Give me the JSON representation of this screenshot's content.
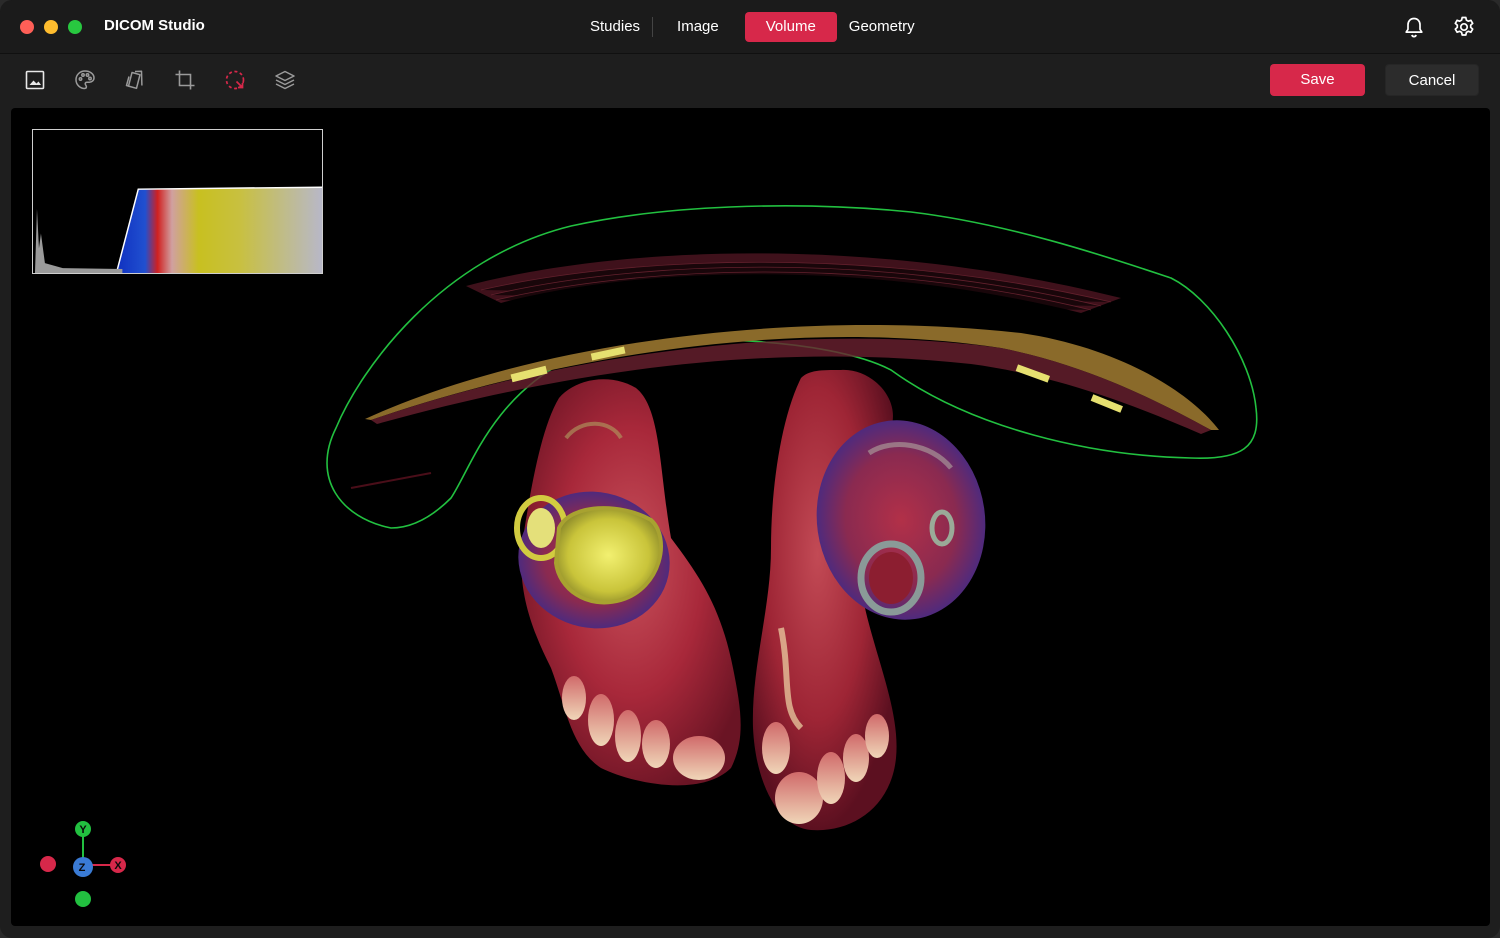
{
  "window": {
    "app_title": "DICOM Studio"
  },
  "tabs": [
    {
      "label": "Studies",
      "active": false
    },
    {
      "label": "Image",
      "active": false
    },
    {
      "label": "Volume",
      "active": true
    },
    {
      "label": "Geometry",
      "active": false
    }
  ],
  "title_icons": [
    "bell-icon",
    "gear-icon"
  ],
  "toolbar": {
    "tools": [
      "image-icon",
      "palette-icon",
      "cards-icon",
      "crop-icon",
      "lasso-select-icon",
      "layers-icon"
    ],
    "active_tool": "lasso-select-icon",
    "save_label": "Save",
    "cancel_label": "Cancel"
  },
  "viewport": {
    "axes": {
      "y": "Y",
      "z": "Z",
      "x": "X"
    }
  },
  "colors": {
    "accent": "#d7284a",
    "roi_outline": "#22c040",
    "axis_x": "#d7284a",
    "axis_y": "#22c040",
    "axis_z": "#3a7bd5"
  }
}
